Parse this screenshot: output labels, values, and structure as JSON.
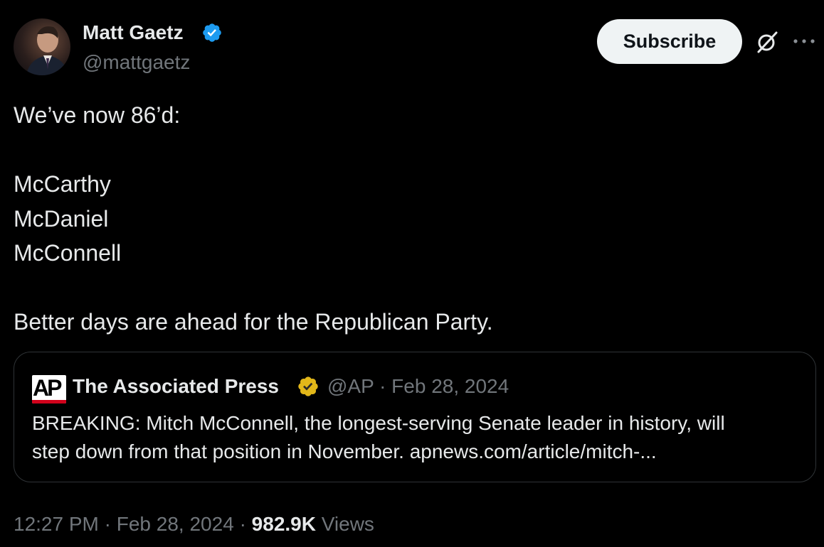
{
  "author": {
    "name": "Matt Gaetz",
    "handle": "@mattgaetz",
    "verified_color": "#1d9bf0"
  },
  "header": {
    "subscribe_label": "Subscribe",
    "grok_icon": "grok-icon",
    "more_icon": "more-icon"
  },
  "tweet": {
    "lines": [
      "We’ve now 86’d:",
      "",
      "McCarthy",
      "McDaniel",
      "McConnell",
      "",
      "Better days are ahead for the Republican Party."
    ]
  },
  "quote": {
    "logo_text": "AP",
    "author_name": "The Associated Press",
    "badge_color": "#e2b719",
    "handle": "@AP",
    "separator": "·",
    "date": "Feb 28, 2024",
    "body_lines": [
      "BREAKING: Mitch McConnell, the longest-serving Senate leader in history, will",
      "step down from that position in November.  apnews.com/article/mitch-..."
    ]
  },
  "footer": {
    "time": "12:27 PM",
    "sep1": "·",
    "date": "Feb 28, 2024",
    "sep2": "·",
    "views_count": "982.9K",
    "views_label": "Views"
  }
}
